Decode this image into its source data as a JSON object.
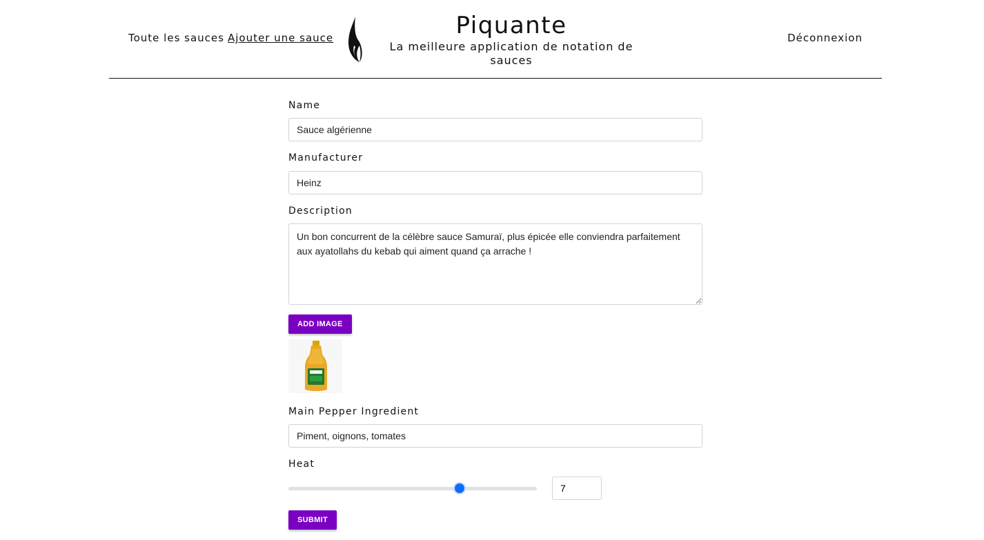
{
  "header": {
    "nav_all": "Toute les sauces",
    "nav_add": "Ajouter une sauce",
    "title": "Piquante",
    "subtitle": "La meilleure application de notation de sauces",
    "logout": "Déconnexion"
  },
  "form": {
    "name_label": "Name",
    "name_value": "Sauce algérienne",
    "manufacturer_label": "Manufacturer",
    "manufacturer_value": "Heinz",
    "description_label": "Description",
    "description_value": "Un bon concurrent de la célèbre sauce Samuraï, plus épicée elle conviendra parfaitement aux ayatollahs du kebab qui aiment quand ça arrache !",
    "add_image_label": "ADD IMAGE",
    "pepper_label": "Main Pepper Ingredient",
    "pepper_value": "Piment, oignons, tomates",
    "heat_label": "Heat",
    "heat_value": "7",
    "heat_max": 10,
    "submit_label": "SUBMIT"
  },
  "colors": {
    "accent": "#7a00c2",
    "slider": "#0d6efd"
  }
}
